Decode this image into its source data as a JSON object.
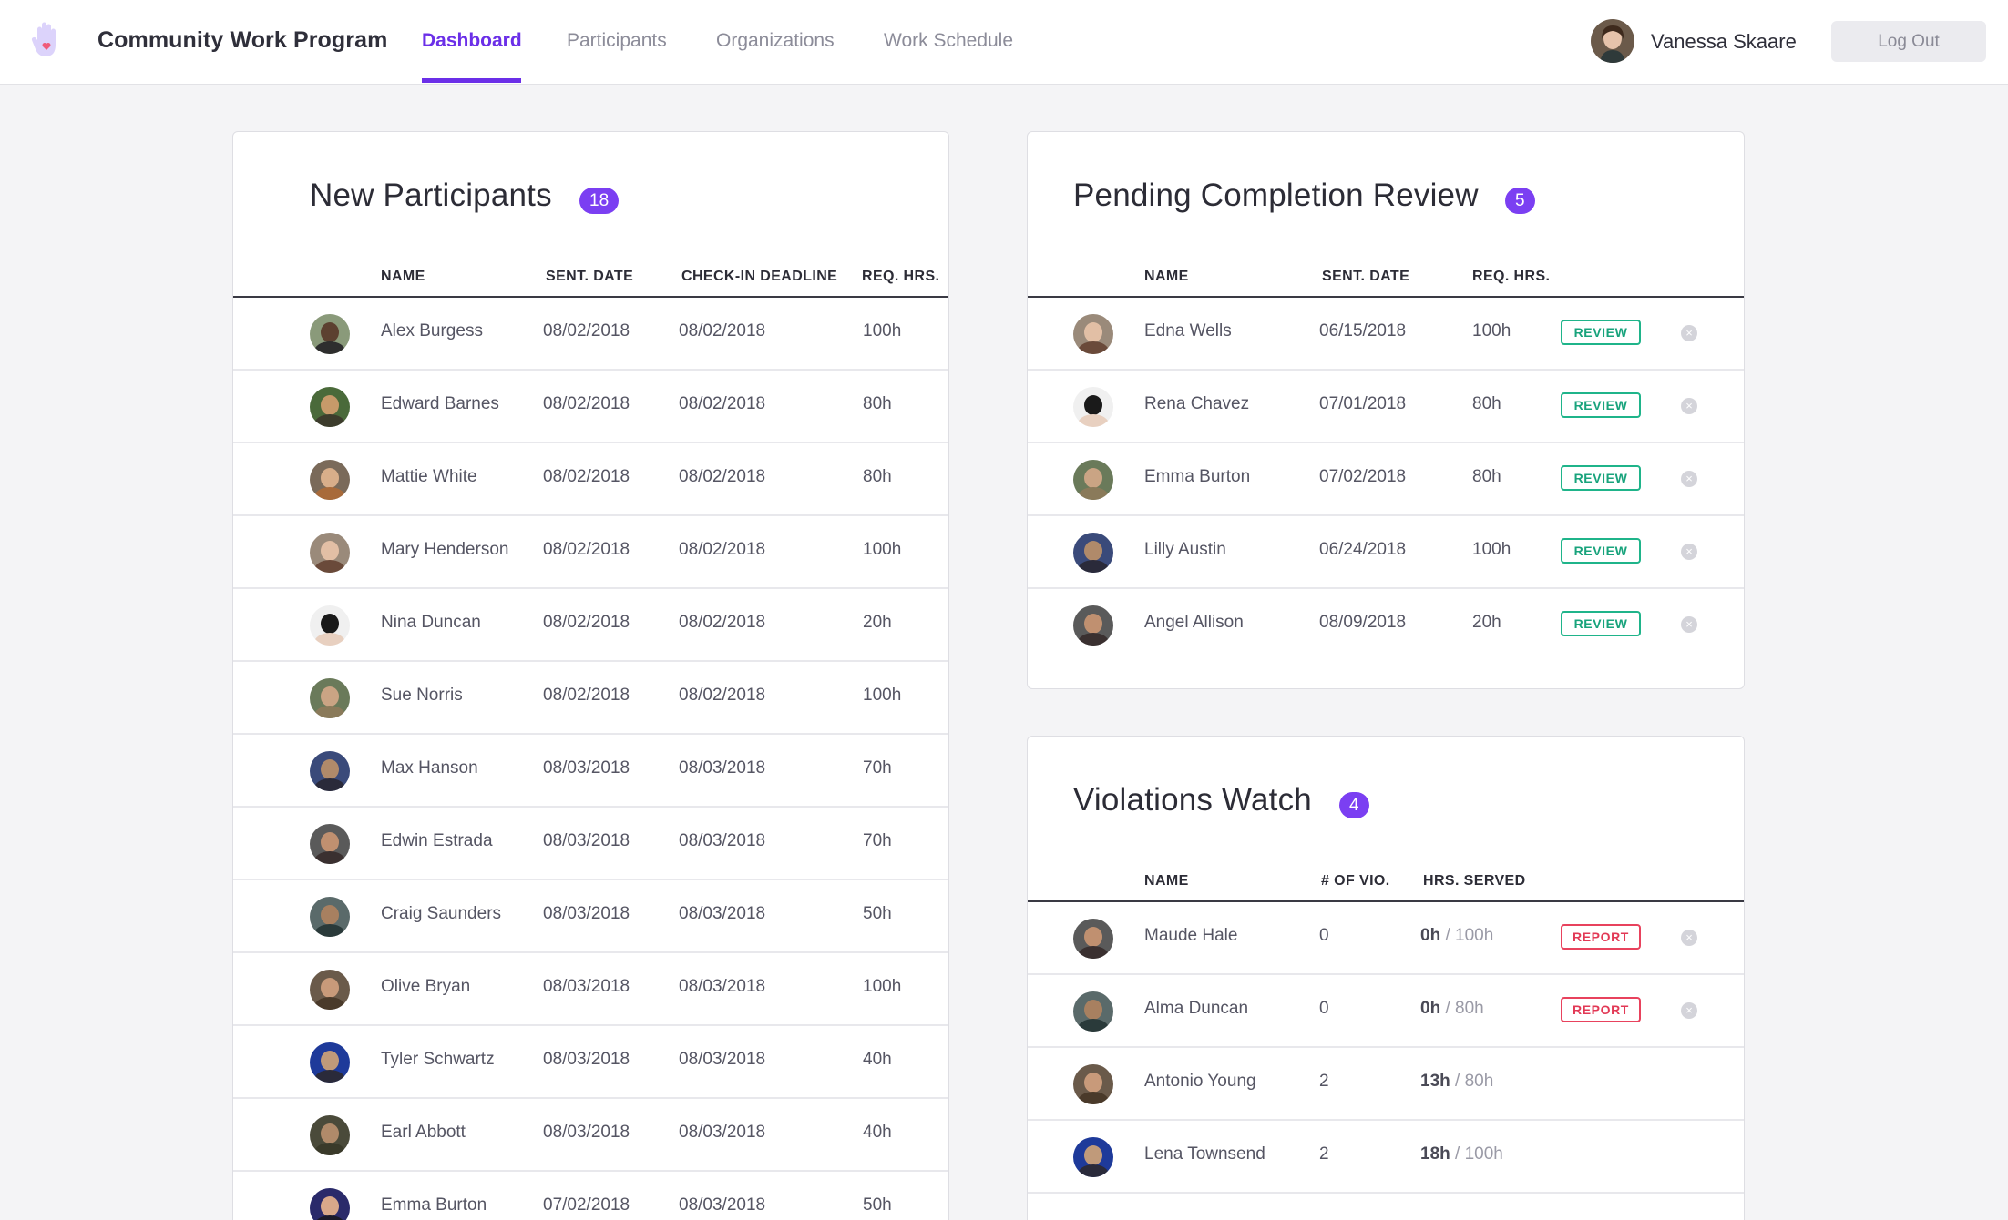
{
  "header": {
    "app_title": "Community Work Program",
    "tabs": [
      {
        "label": "Dashboard",
        "active": true
      },
      {
        "label": "Participants",
        "active": false
      },
      {
        "label": "Organizations",
        "active": false
      },
      {
        "label": "Work Schedule",
        "active": false
      }
    ],
    "user_name": "Vanessa Skaare",
    "logout_label": "Log Out"
  },
  "colors": {
    "accent": "#6b2fe8",
    "badge": "#7b3ff2",
    "review": "#1fb48a",
    "report": "#e8425d"
  },
  "new_participants": {
    "title": "New Participants",
    "count": "18",
    "columns": {
      "name": "NAME",
      "sent": "SENT. DATE",
      "deadline": "CHECK-IN DEADLINE",
      "hours": "REQ. HRS."
    },
    "rows": [
      {
        "name": "Alex Burgess",
        "sent": "08/02/2018",
        "deadline": "08/02/2018",
        "hours": "100h"
      },
      {
        "name": "Edward Barnes",
        "sent": "08/02/2018",
        "deadline": "08/02/2018",
        "hours": "80h"
      },
      {
        "name": "Mattie White",
        "sent": "08/02/2018",
        "deadline": "08/02/2018",
        "hours": "80h"
      },
      {
        "name": "Mary Henderson",
        "sent": "08/02/2018",
        "deadline": "08/02/2018",
        "hours": "100h"
      },
      {
        "name": "Nina Duncan",
        "sent": "08/02/2018",
        "deadline": "08/02/2018",
        "hours": "20h"
      },
      {
        "name": "Sue Norris",
        "sent": "08/02/2018",
        "deadline": "08/02/2018",
        "hours": "100h"
      },
      {
        "name": "Max Hanson",
        "sent": "08/03/2018",
        "deadline": "08/03/2018",
        "hours": "70h"
      },
      {
        "name": "Edwin Estrada",
        "sent": "08/03/2018",
        "deadline": "08/03/2018",
        "hours": "70h"
      },
      {
        "name": "Craig Saunders",
        "sent": "08/03/2018",
        "deadline": "08/03/2018",
        "hours": "50h"
      },
      {
        "name": "Olive Bryan",
        "sent": "08/03/2018",
        "deadline": "08/03/2018",
        "hours": "100h"
      },
      {
        "name": "Tyler Schwartz",
        "sent": "08/03/2018",
        "deadline": "08/03/2018",
        "hours": "40h"
      },
      {
        "name": "Earl Abbott",
        "sent": "08/03/2018",
        "deadline": "08/03/2018",
        "hours": "40h"
      },
      {
        "name": "Emma Burton",
        "sent": "07/02/2018",
        "deadline": "08/03/2018",
        "hours": "50h"
      }
    ]
  },
  "pending_review": {
    "title": "Pending Completion Review",
    "count": "5",
    "columns": {
      "name": "NAME",
      "sent": "SENT. DATE",
      "hours": "REQ. HRS."
    },
    "action_label": "REVIEW",
    "rows": [
      {
        "name": "Edna Wells",
        "sent": "06/15/2018",
        "hours": "100h"
      },
      {
        "name": "Rena Chavez",
        "sent": "07/01/2018",
        "hours": "80h"
      },
      {
        "name": "Emma Burton",
        "sent": "07/02/2018",
        "hours": "80h"
      },
      {
        "name": "Lilly Austin",
        "sent": "06/24/2018",
        "hours": "100h"
      },
      {
        "name": "Angel Allison",
        "sent": "08/09/2018",
        "hours": "20h"
      }
    ]
  },
  "violations": {
    "title": "Violations Watch",
    "count": "4",
    "columns": {
      "name": "NAME",
      "vio": "# OF VIO.",
      "served": "HRS. SERVED"
    },
    "action_label": "REPORT",
    "rows": [
      {
        "name": "Maude Hale",
        "vio": "0",
        "served": "0h",
        "required": " / 100h",
        "report": true
      },
      {
        "name": "Alma Duncan",
        "vio": "0",
        "served": "0h",
        "required": " / 80h",
        "report": true
      },
      {
        "name": "Antonio Young",
        "vio": "2",
        "served": "13h",
        "required": " / 80h",
        "report": false
      },
      {
        "name": "Lena Townsend",
        "vio": "2",
        "served": "18h",
        "required": " / 100h",
        "report": false
      }
    ]
  }
}
